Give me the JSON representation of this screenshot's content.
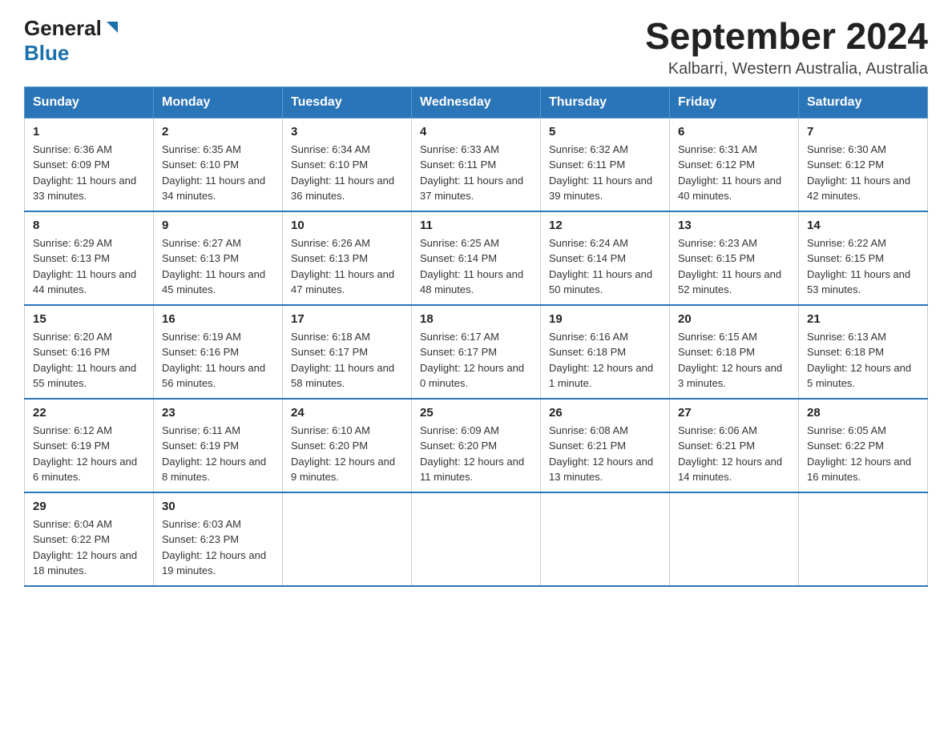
{
  "header": {
    "logo_general": "General",
    "logo_blue": "Blue",
    "main_title": "September 2024",
    "subtitle": "Kalbarri, Western Australia, Australia"
  },
  "days_of_week": [
    "Sunday",
    "Monday",
    "Tuesday",
    "Wednesday",
    "Thursday",
    "Friday",
    "Saturday"
  ],
  "weeks": [
    [
      {
        "day": "1",
        "sunrise": "6:36 AM",
        "sunset": "6:09 PM",
        "daylight": "11 hours and 33 minutes."
      },
      {
        "day": "2",
        "sunrise": "6:35 AM",
        "sunset": "6:10 PM",
        "daylight": "11 hours and 34 minutes."
      },
      {
        "day": "3",
        "sunrise": "6:34 AM",
        "sunset": "6:10 PM",
        "daylight": "11 hours and 36 minutes."
      },
      {
        "day": "4",
        "sunrise": "6:33 AM",
        "sunset": "6:11 PM",
        "daylight": "11 hours and 37 minutes."
      },
      {
        "day": "5",
        "sunrise": "6:32 AM",
        "sunset": "6:11 PM",
        "daylight": "11 hours and 39 minutes."
      },
      {
        "day": "6",
        "sunrise": "6:31 AM",
        "sunset": "6:12 PM",
        "daylight": "11 hours and 40 minutes."
      },
      {
        "day": "7",
        "sunrise": "6:30 AM",
        "sunset": "6:12 PM",
        "daylight": "11 hours and 42 minutes."
      }
    ],
    [
      {
        "day": "8",
        "sunrise": "6:29 AM",
        "sunset": "6:13 PM",
        "daylight": "11 hours and 44 minutes."
      },
      {
        "day": "9",
        "sunrise": "6:27 AM",
        "sunset": "6:13 PM",
        "daylight": "11 hours and 45 minutes."
      },
      {
        "day": "10",
        "sunrise": "6:26 AM",
        "sunset": "6:13 PM",
        "daylight": "11 hours and 47 minutes."
      },
      {
        "day": "11",
        "sunrise": "6:25 AM",
        "sunset": "6:14 PM",
        "daylight": "11 hours and 48 minutes."
      },
      {
        "day": "12",
        "sunrise": "6:24 AM",
        "sunset": "6:14 PM",
        "daylight": "11 hours and 50 minutes."
      },
      {
        "day": "13",
        "sunrise": "6:23 AM",
        "sunset": "6:15 PM",
        "daylight": "11 hours and 52 minutes."
      },
      {
        "day": "14",
        "sunrise": "6:22 AM",
        "sunset": "6:15 PM",
        "daylight": "11 hours and 53 minutes."
      }
    ],
    [
      {
        "day": "15",
        "sunrise": "6:20 AM",
        "sunset": "6:16 PM",
        "daylight": "11 hours and 55 minutes."
      },
      {
        "day": "16",
        "sunrise": "6:19 AM",
        "sunset": "6:16 PM",
        "daylight": "11 hours and 56 minutes."
      },
      {
        "day": "17",
        "sunrise": "6:18 AM",
        "sunset": "6:17 PM",
        "daylight": "11 hours and 58 minutes."
      },
      {
        "day": "18",
        "sunrise": "6:17 AM",
        "sunset": "6:17 PM",
        "daylight": "12 hours and 0 minutes."
      },
      {
        "day": "19",
        "sunrise": "6:16 AM",
        "sunset": "6:18 PM",
        "daylight": "12 hours and 1 minute."
      },
      {
        "day": "20",
        "sunrise": "6:15 AM",
        "sunset": "6:18 PM",
        "daylight": "12 hours and 3 minutes."
      },
      {
        "day": "21",
        "sunrise": "6:13 AM",
        "sunset": "6:18 PM",
        "daylight": "12 hours and 5 minutes."
      }
    ],
    [
      {
        "day": "22",
        "sunrise": "6:12 AM",
        "sunset": "6:19 PM",
        "daylight": "12 hours and 6 minutes."
      },
      {
        "day": "23",
        "sunrise": "6:11 AM",
        "sunset": "6:19 PM",
        "daylight": "12 hours and 8 minutes."
      },
      {
        "day": "24",
        "sunrise": "6:10 AM",
        "sunset": "6:20 PM",
        "daylight": "12 hours and 9 minutes."
      },
      {
        "day": "25",
        "sunrise": "6:09 AM",
        "sunset": "6:20 PM",
        "daylight": "12 hours and 11 minutes."
      },
      {
        "day": "26",
        "sunrise": "6:08 AM",
        "sunset": "6:21 PM",
        "daylight": "12 hours and 13 minutes."
      },
      {
        "day": "27",
        "sunrise": "6:06 AM",
        "sunset": "6:21 PM",
        "daylight": "12 hours and 14 minutes."
      },
      {
        "day": "28",
        "sunrise": "6:05 AM",
        "sunset": "6:22 PM",
        "daylight": "12 hours and 16 minutes."
      }
    ],
    [
      {
        "day": "29",
        "sunrise": "6:04 AM",
        "sunset": "6:22 PM",
        "daylight": "12 hours and 18 minutes."
      },
      {
        "day": "30",
        "sunrise": "6:03 AM",
        "sunset": "6:23 PM",
        "daylight": "12 hours and 19 minutes."
      },
      null,
      null,
      null,
      null,
      null
    ]
  ],
  "labels": {
    "sunrise": "Sunrise:",
    "sunset": "Sunset:",
    "daylight": "Daylight:"
  }
}
